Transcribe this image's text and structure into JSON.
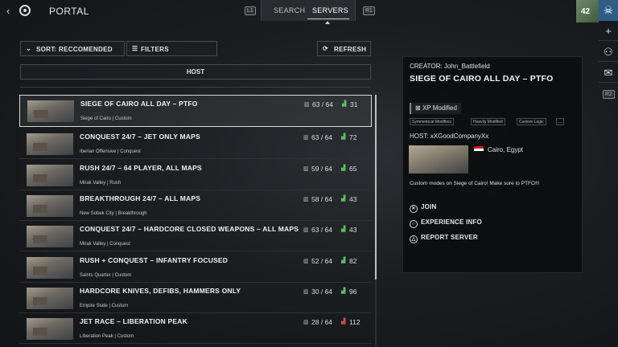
{
  "topbar": {
    "back_icon": "chevron-left-icon",
    "portal_title": "PORTAL",
    "hint_left": "L1",
    "hint_right": "R1",
    "tabs": [
      {
        "label": "SEARCH"
      },
      {
        "label": "SERVERS"
      }
    ]
  },
  "rail": {
    "avatar_level": "42",
    "hint_r2": "R2",
    "icons": [
      "skull-icon",
      "plus-icon",
      "party-icon",
      "mail-icon"
    ]
  },
  "controls": {
    "sort_label": "SORT: RECCOMENDED",
    "filters_label": "FILTERS",
    "refresh_label": "REFRESH",
    "host_label": "HOST"
  },
  "servers": [
    {
      "name": "SIEGE OF CAIRO ALL DAY – PTFO",
      "sub": "Siege of Cairo | Custom",
      "players": "63 / 64",
      "ping": "31",
      "ping_status": "good"
    },
    {
      "name": "CONQUEST 24/7 – JET ONLY MAPS",
      "sub": "Iberian Offensive | Conquest",
      "players": "63 / 64",
      "ping": "72",
      "ping_status": "good"
    },
    {
      "name": "RUSH 24/7 – 64  PLAYER, ALL MAPS",
      "sub": "Mirak Valley | Rush",
      "players": "59 / 64",
      "ping": "65",
      "ping_status": "good"
    },
    {
      "name": "BREAKTHROUGH 24/7 – ALL MAPS",
      "sub": "New Sobek City | Breakthrough",
      "players": "58 / 64",
      "ping": "43",
      "ping_status": "good"
    },
    {
      "name": "CONQUEST 24/7 – HARDCORE CLOSED WEAPONS – ALL MAPS",
      "sub": "Mirak Valley | Conquest",
      "players": "63 / 64",
      "ping": "43",
      "ping_status": "good"
    },
    {
      "name": "RUSH + CONQUEST – INFANTRY FOCUSED",
      "sub": "Saints Quarter | Custom",
      "players": "52 / 64",
      "ping": "82",
      "ping_status": "good"
    },
    {
      "name": "HARDCORE KNIVES, DEFIBS, HAMMERS ONLY",
      "sub": "Empire State | Custom",
      "players": "30 / 64",
      "ping": "96",
      "ping_status": "good"
    },
    {
      "name": "JET RACE – LIBERATION PEAK",
      "sub": "Liberation Peak | Custom",
      "players": "28 / 64",
      "ping": "112",
      "ping_status": "bad"
    }
  ],
  "detail": {
    "creator": "CREATOR: John_Battlefield",
    "title": "SIEGE OF CAIRO ALL DAY – PTFO",
    "xp_tag": "XP Modified",
    "mod_tags": [
      "Symmetrical Modifiers",
      "Heavily Modified",
      "Custom Logic",
      "..."
    ],
    "host": "HOST: xXGoodCompanyXx",
    "location": "Cairo, Egypt",
    "description": "Custom modes on Siege of Cairo! Make sure to PTFO!!!",
    "actions": [
      {
        "label": "JOIN",
        "icon": "cross-button-icon"
      },
      {
        "label": "EXPERIENCE INFO",
        "icon": "circle-button-icon"
      },
      {
        "label": "REPORT SERVER",
        "icon": "triangle-button-icon"
      }
    ]
  }
}
